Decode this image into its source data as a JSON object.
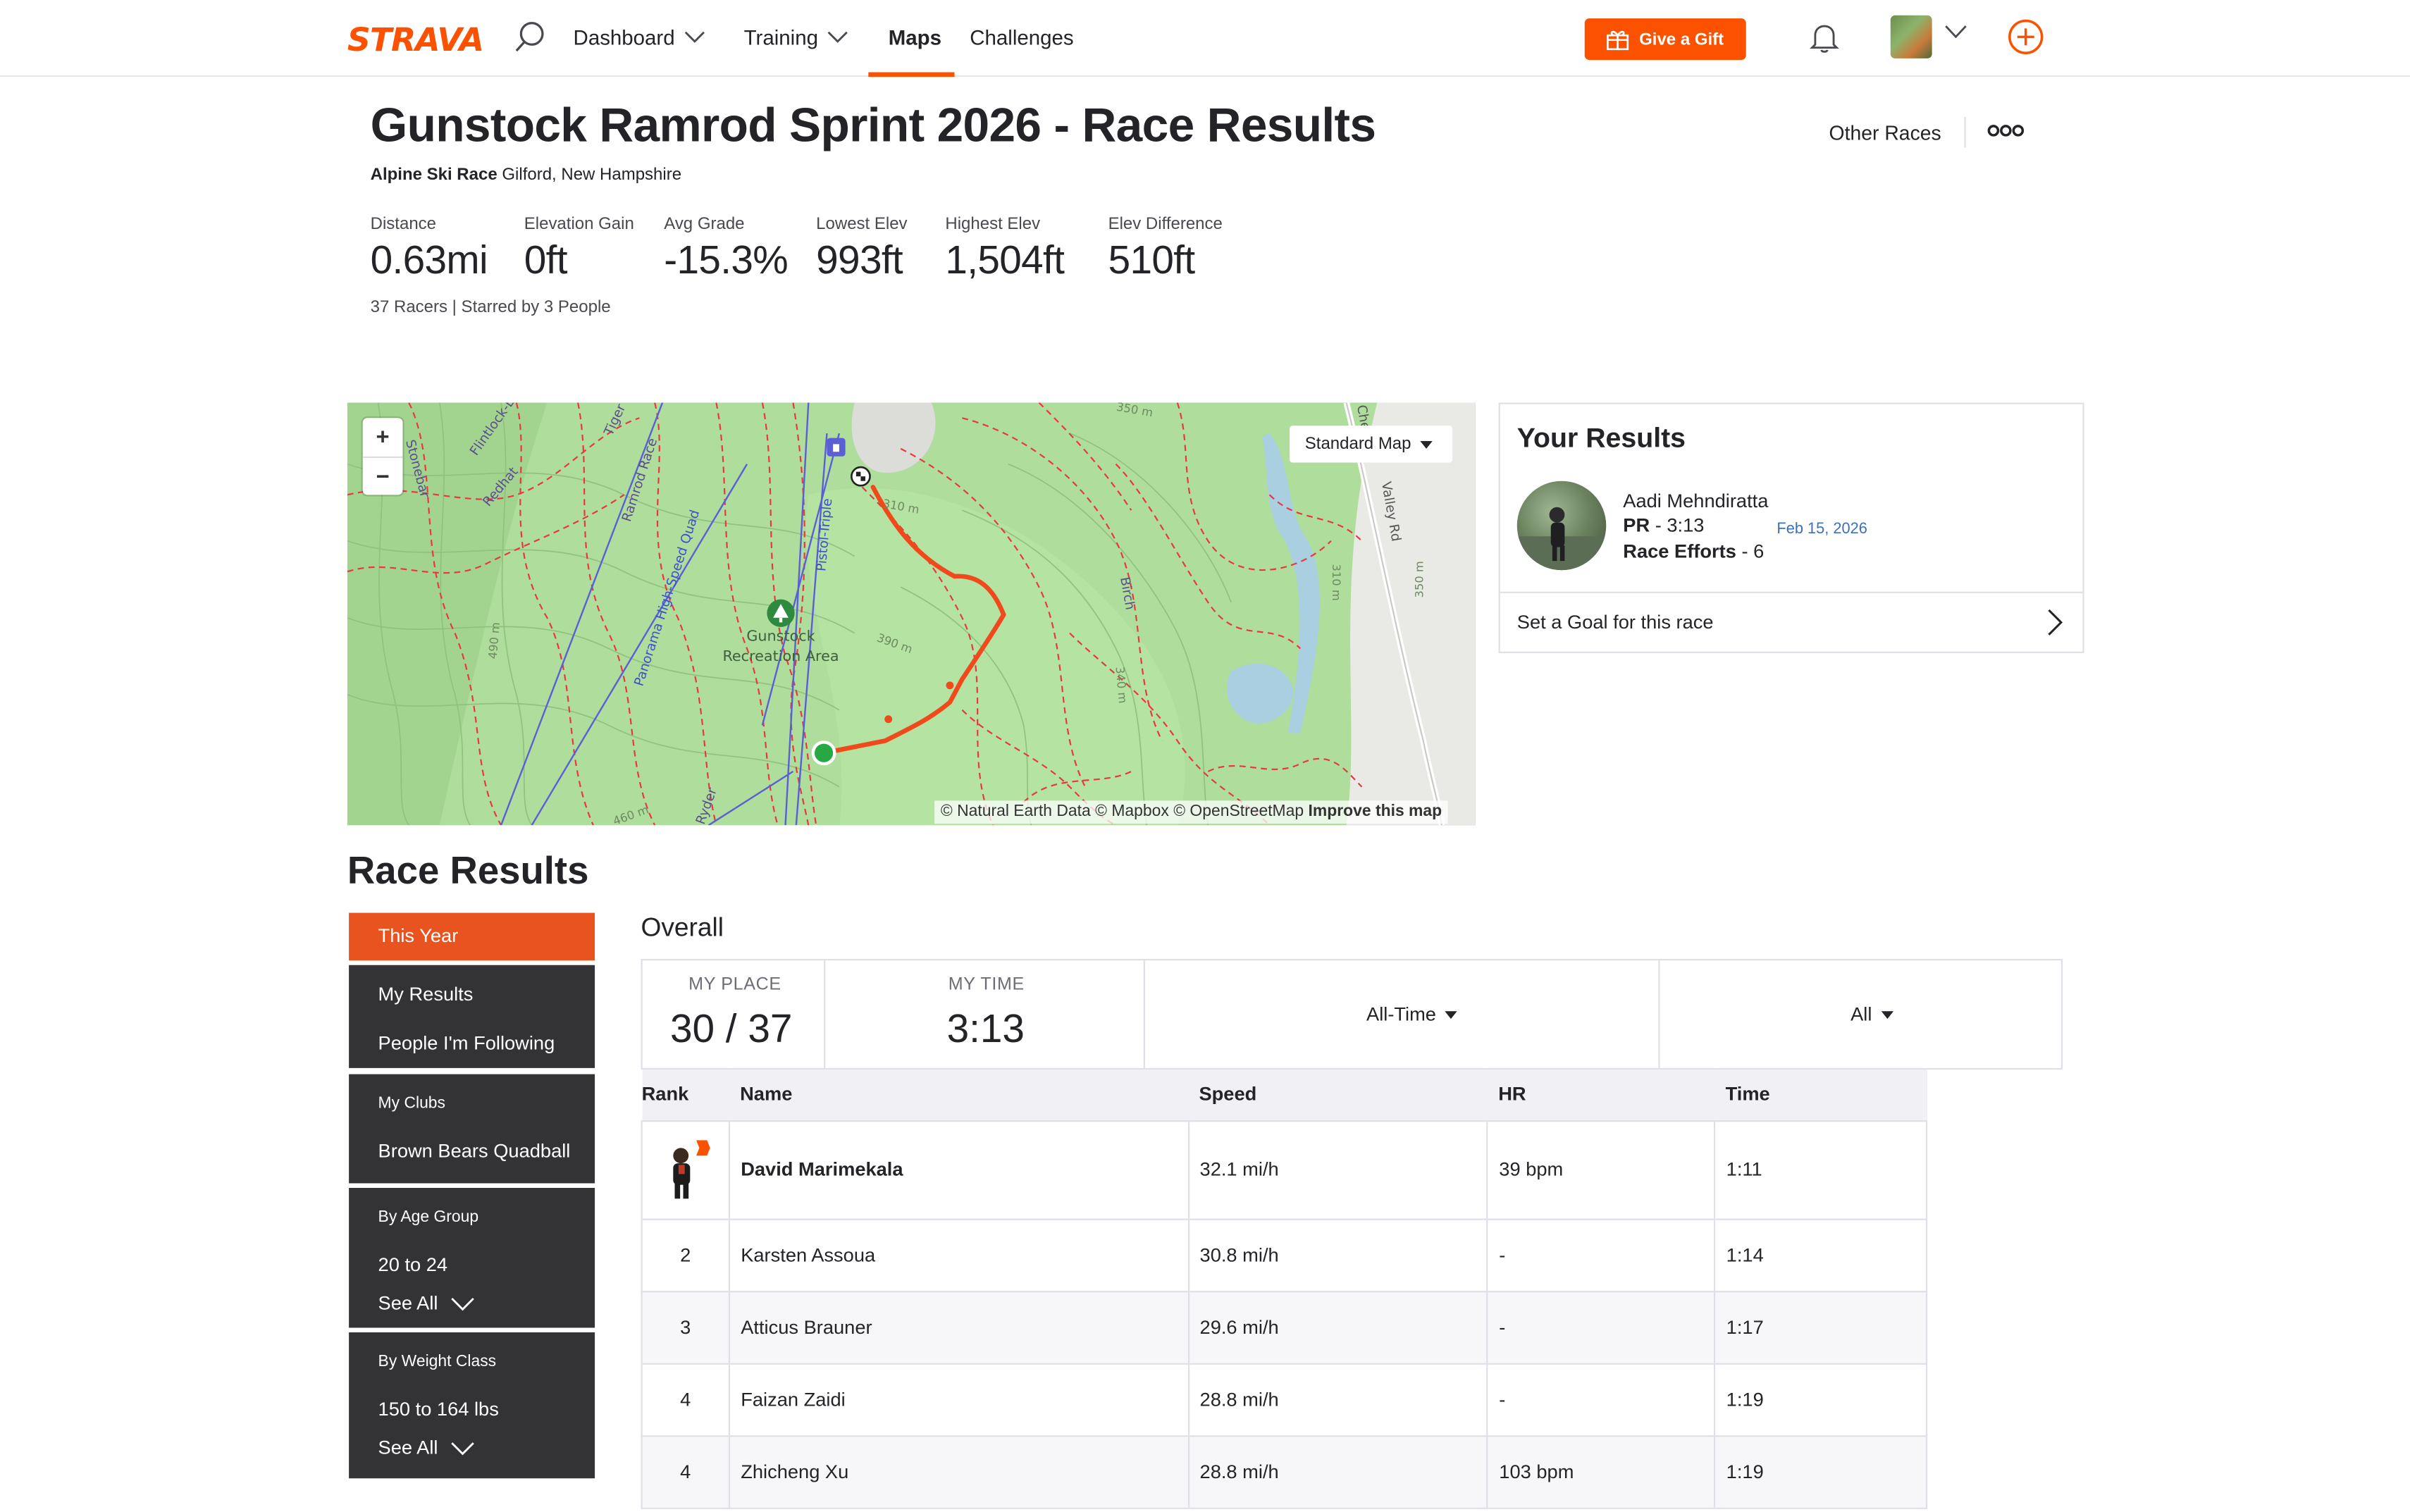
{
  "nav": {
    "logo": "STRAVA",
    "items": [
      "Dashboard",
      "Training",
      "Maps",
      "Challenges"
    ],
    "gift_label": "Give a Gift"
  },
  "header": {
    "title": "Gunstock Ramrod Sprint 2026 - Race Results",
    "race_type": "Alpine Ski Race",
    "location": "Gilford, New Hampshire",
    "other_races": "Other Races",
    "stats": [
      {
        "label": "Distance",
        "value": "0.63mi"
      },
      {
        "label": "Elevation Gain",
        "value": "0ft"
      },
      {
        "label": "Avg Grade",
        "value": "-15.3%"
      },
      {
        "label": "Lowest Elev",
        "value": "993ft"
      },
      {
        "label": "Highest Elev",
        "value": "1,504ft"
      },
      {
        "label": "Elev Difference",
        "value": "510ft"
      }
    ],
    "racers_line": "37 Racers | Starred by 3 People"
  },
  "map": {
    "map_type": "Standard Map",
    "labels": {
      "poi": "Gunstock",
      "poi2": "Recreation Area",
      "trail1": "Flintlock-Ex",
      "trail2": "Stonebar",
      "trail3": "Redhat",
      "trail4": "Tiger",
      "trail5": "Ramrod Race",
      "trail6": "Panorama High-Speed Quad",
      "trail7": "Pistol-Triple",
      "trail8": "Birch",
      "road": "Valley Rd",
      "road_prefix": "Che",
      "c1": "350 m",
      "c2": "310 m",
      "c3": "310 m",
      "c4": "350 m",
      "c5": "490 m",
      "c6": "390 m",
      "c7": "340 m",
      "c8": "460 m",
      "trail9": "Ryder"
    },
    "attribution": "© Natural Earth Data © Mapbox © OpenStreetMap",
    "improve": "Improve this map"
  },
  "your_results": {
    "title": "Your Results",
    "name": "Aadi Mehndiratta",
    "pr_label": "PR",
    "pr_value": " - 3:13",
    "date": "Feb 15, 2026",
    "efforts_label": "Race Efforts",
    "efforts_value": " - 6",
    "goal": "Set a Goal for this race"
  },
  "results": {
    "title": "Race Results",
    "sidebar": {
      "this_year": "This Year",
      "my_results": "My Results",
      "following": "People I'm Following",
      "clubs_header": "My Clubs",
      "club": "Brown Bears Quadball",
      "age_header": "By Age Group",
      "age": "20 to 24",
      "weight_header": "By Weight Class",
      "weight": "150 to 164 lbs",
      "see_all": "See All"
    },
    "overall": "Overall",
    "my_place_label": "MY PLACE",
    "my_place": "30 / 37",
    "my_time_label": "MY TIME",
    "my_time": "3:13",
    "filter_time": "All-Time",
    "filter_group": "All",
    "columns": [
      "Rank",
      "Name",
      "Speed",
      "HR",
      "Time"
    ],
    "rows": [
      {
        "rank": "",
        "name": "David Marimekala",
        "speed": "32.1 mi/h",
        "hr": "39 bpm",
        "time": "1:11"
      },
      {
        "rank": "2",
        "name": "Karsten Assoua",
        "speed": "30.8 mi/h",
        "hr": "-",
        "time": "1:14"
      },
      {
        "rank": "3",
        "name": "Atticus Brauner",
        "speed": "29.6 mi/h",
        "hr": "-",
        "time": "1:17"
      },
      {
        "rank": "4",
        "name": "Faizan Zaidi",
        "speed": "28.8 mi/h",
        "hr": "-",
        "time": "1:19"
      },
      {
        "rank": "4",
        "name": "Zhicheng Xu",
        "speed": "28.8 mi/h",
        "hr": "103 bpm",
        "time": "1:19"
      }
    ]
  },
  "colors": {
    "brand": "#fc5200",
    "sidebar_bg": "#333336",
    "active": "#e8531f"
  },
  "icons": [
    "search-icon",
    "chevron-down-icon",
    "gift-icon",
    "bell-icon",
    "plus-circle-icon",
    "more-icon",
    "chevron-right-icon",
    "finish-flag-icon",
    "tree-icon",
    "lift-icon"
  ]
}
